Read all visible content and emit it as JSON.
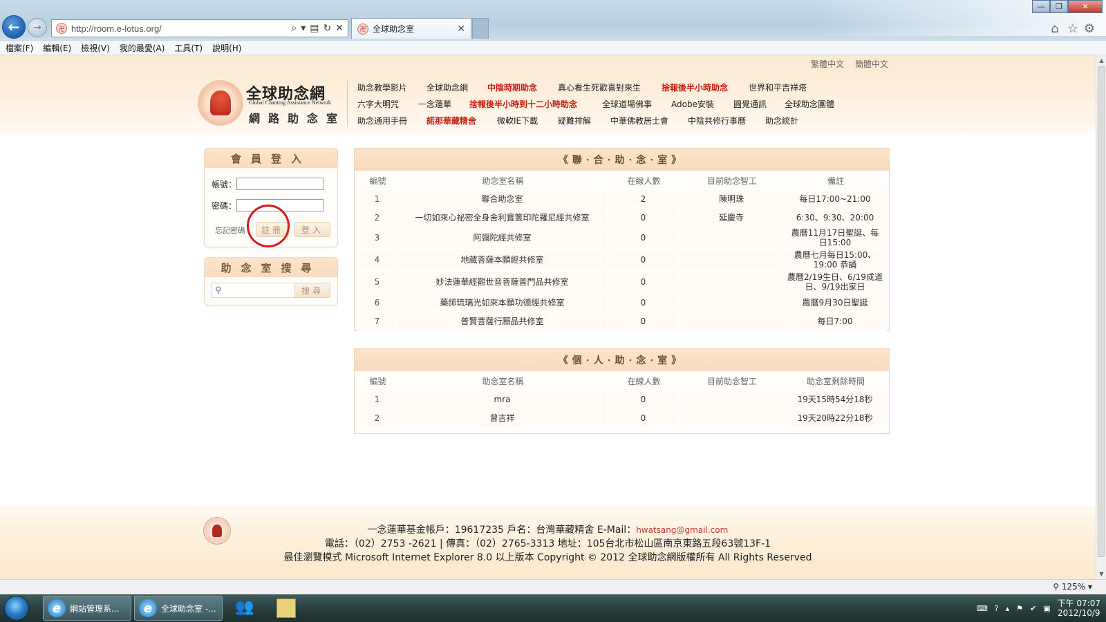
{
  "browser": {
    "url": "http://room.e-lotus.org/",
    "tab_title": "全球助念室",
    "menu": [
      "檔案(F)",
      "編輯(E)",
      "檢視(V)",
      "我的最愛(A)",
      "工具(T)",
      "說明(H)"
    ]
  },
  "site": {
    "lang_links": [
      "繁體中文",
      "簡體中文"
    ],
    "title": "全球助念網",
    "subtitle_en": "Global Chanting Assistance Network",
    "subtitle_zh": "網路助念室",
    "nav_rows": [
      [
        {
          "label": "助念教學影片",
          "hl": false
        },
        {
          "label": "全球助念網",
          "hl": false
        },
        {
          "label": "中陰時期助念",
          "hl": true
        },
        {
          "label": "真心看生死歡喜對來生",
          "hl": false
        },
        {
          "label": "捨報後半小時助念",
          "hl": true
        },
        {
          "label": "世界和平吉祥塔",
          "hl": false
        }
      ],
      [
        {
          "label": "六字大明咒",
          "hl": false
        },
        {
          "label": "一念蓮華",
          "hl": false
        },
        {
          "label": "捨報後半小時到十二小時助念",
          "hl": true
        },
        {
          "label": "全球道場佛事",
          "hl": false
        },
        {
          "label": "Adobe安裝",
          "hl": false
        },
        {
          "label": "圓覺通訊",
          "hl": false
        },
        {
          "label": "全球助念團體",
          "hl": false
        }
      ],
      [
        {
          "label": "助念通用手冊",
          "hl": false
        },
        {
          "label": "諾那華藏精舍",
          "hl": true
        },
        {
          "label": "微軟IE下載",
          "hl": false
        },
        {
          "label": "疑難排解",
          "hl": false
        },
        {
          "label": "中華佛教居士會",
          "hl": false
        },
        {
          "label": "中陰共修行事曆",
          "hl": false
        },
        {
          "label": "助念統計",
          "hl": false
        }
      ]
    ]
  },
  "login": {
    "heading": "會員登入",
    "account_label": "帳號：",
    "password_label": "密碼：",
    "forgot_label": "忘記密碼",
    "register_label": "註冊",
    "login_label": "登入"
  },
  "room_search": {
    "heading": "助念室搜尋",
    "button_label": "搜尋"
  },
  "joint_rooms": {
    "heading": "《聯·合·助·念·室》",
    "columns": [
      "編號",
      "助念室名稱",
      "在線人數",
      "目前助念智工",
      "備註"
    ],
    "rows": [
      [
        "1",
        "聯合助念室",
        "2",
        "陳明珠",
        "每日17:00~21:00"
      ],
      [
        "2",
        "一切如來心祕密全身舍利寶篋印陀羅尼經共修室",
        "0",
        "延慶寺",
        "6:30、9:30、20:00"
      ],
      [
        "3",
        "阿彌陀經共修室",
        "0",
        "",
        "農曆11月17日聖誕、每日15:00"
      ],
      [
        "4",
        "地藏菩薩本願經共修室",
        "0",
        "",
        "農曆七月每日15:00、19:00 恭誦"
      ],
      [
        "5",
        "妙法蓮華經觀世音菩薩普門品共修室",
        "0",
        "",
        "農曆2/19生日、6/19成道日、9/19出家日"
      ],
      [
        "6",
        "藥師琉璃光如來本願功德經共修室",
        "0",
        "",
        "農曆9月30日聖誕"
      ],
      [
        "7",
        "普賢菩薩行願品共修室",
        "0",
        "",
        "每日7:00"
      ]
    ]
  },
  "personal_rooms": {
    "heading": "《個·人·助·念·室》",
    "columns": [
      "編號",
      "助念室名稱",
      "在線人數",
      "目前助念智工",
      "助念室剩餘時間"
    ],
    "rows": [
      [
        "1",
        "mra",
        "0",
        "",
        "19天15時54分18秒"
      ],
      [
        "2",
        "曾吉祥",
        "0",
        "",
        "19天20時22分18秒"
      ]
    ]
  },
  "footer": {
    "line1_prefix": "一念蓮華基金帳戶：19617235   戶名：台灣華藏精舍   E-Mail：",
    "email": "hwatsang@gmail.com",
    "line2": "電話：（02）2753 -2621  |  傳真：（02）2765-3313   地址：105台北市松山區南京東路五段63號13F-1",
    "line3": "最佳瀏覽模式  Microsoft Internet Explorer 8.0   以上版本   Copyright © 2012 全球助念網版權所有 All Rights Reserved"
  },
  "statusbar": {
    "zoom": "125%"
  },
  "taskbar": {
    "task1_label": "網站管理系...",
    "task2_label": "全球助念室 -...",
    "clock_time": "下午 07:07",
    "clock_date": "2012/10/9"
  },
  "colors": {
    "highlight_red": "#c91e12",
    "banner_peach": "#fbe9cf",
    "circle_red": "#d61a1a"
  }
}
